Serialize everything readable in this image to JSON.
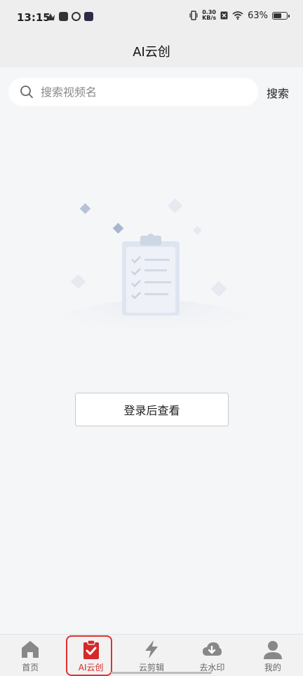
{
  "status_bar": {
    "time": "13:15",
    "net_speed_value": "0.30",
    "net_speed_unit": "KB/s",
    "battery_percent_label": "63%",
    "battery_level": 0.63
  },
  "header": {
    "title": "AI云创"
  },
  "search": {
    "placeholder": "搜索视频名",
    "button_label": "搜索"
  },
  "main": {
    "login_button_label": "登录后查看"
  },
  "bottom_nav": {
    "items": [
      {
        "label": "首页",
        "icon": "home-icon",
        "active": false
      },
      {
        "label": "AI云创",
        "icon": "clipboard-check-icon",
        "active": true
      },
      {
        "label": "云剪辑",
        "icon": "lightning-icon",
        "active": false
      },
      {
        "label": "去水印",
        "icon": "cloud-download-icon",
        "active": false
      },
      {
        "label": "我的",
        "icon": "profile-icon",
        "active": false
      }
    ]
  },
  "colors": {
    "accent": "#d42a2a",
    "background": "#f5f6f8",
    "header_bg": "#eeeeee",
    "inactive_icon": "#888888"
  }
}
